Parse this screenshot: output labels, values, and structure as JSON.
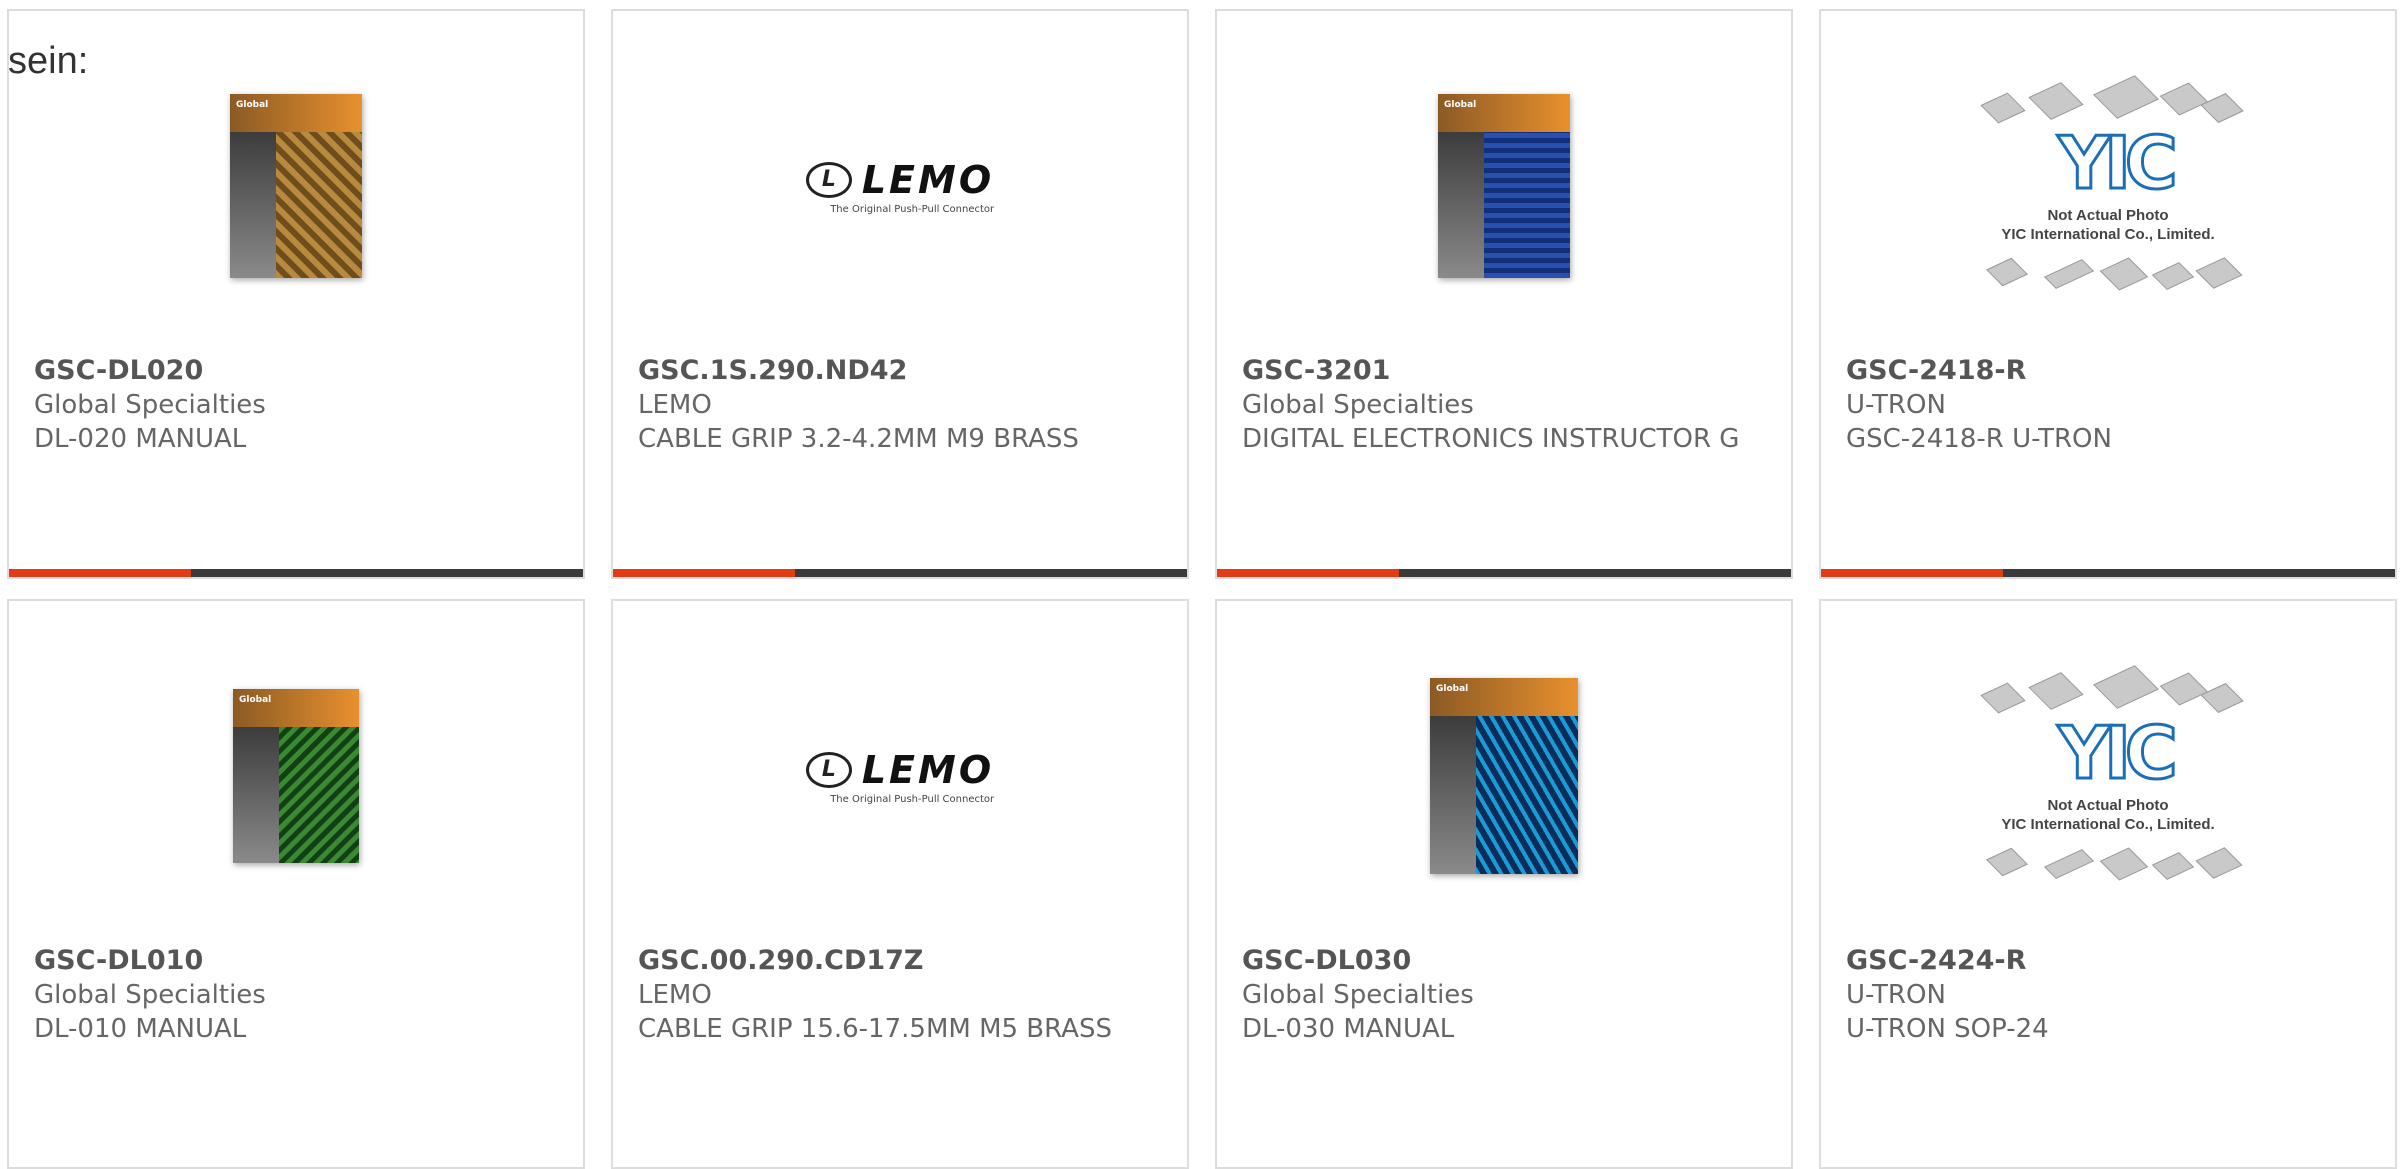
{
  "page_fragment": "sein:",
  "yic_note_line1": "Not Actual Photo",
  "yic_note_line2": "YIC International Co., Limited.",
  "lemo_logo": {
    "word": "LEMO",
    "tagline": "The Original Push-Pull Connector"
  },
  "products": [
    {
      "sku": "GSC-DL020",
      "brand": "Global Specialties",
      "desc": "DL-020 MANUAL",
      "image": "book-cover-gold"
    },
    {
      "sku": "GSC.1S.290.ND42",
      "brand": "LEMO",
      "desc": "CABLE GRIP 3.2-4.2MM M9 BRASS",
      "image": "lemo-logo"
    },
    {
      "sku": "GSC-3201",
      "brand": "Global Specialties",
      "desc": "DIGITAL ELECTRONICS INSTRUCTOR G",
      "image": "book-cover-blue"
    },
    {
      "sku": "GSC-2418-R",
      "brand": "U-TRON",
      "desc": "GSC-2418-R U-TRON",
      "image": "yic-placeholder"
    },
    {
      "sku": "GSC-DL010",
      "brand": "Global Specialties",
      "desc": "DL-010 MANUAL",
      "image": "book-cover-green"
    },
    {
      "sku": "GSC.00.290.CD17Z",
      "brand": "LEMO",
      "desc": "CABLE GRIP 15.6-17.5MM M5 BRASS",
      "image": "lemo-logo"
    },
    {
      "sku": "GSC-DL030",
      "brand": "Global Specialties",
      "desc": "DL-030 MANUAL",
      "image": "book-cover-cyan"
    },
    {
      "sku": "GSC-2424-R",
      "brand": "U-TRON",
      "desc": "U-TRON SOP-24",
      "image": "yic-placeholder"
    }
  ],
  "colors": {
    "accent": "#e03c15",
    "bar": "#3a3a3a",
    "border": "#dcdcdc",
    "text": "#666666"
  }
}
